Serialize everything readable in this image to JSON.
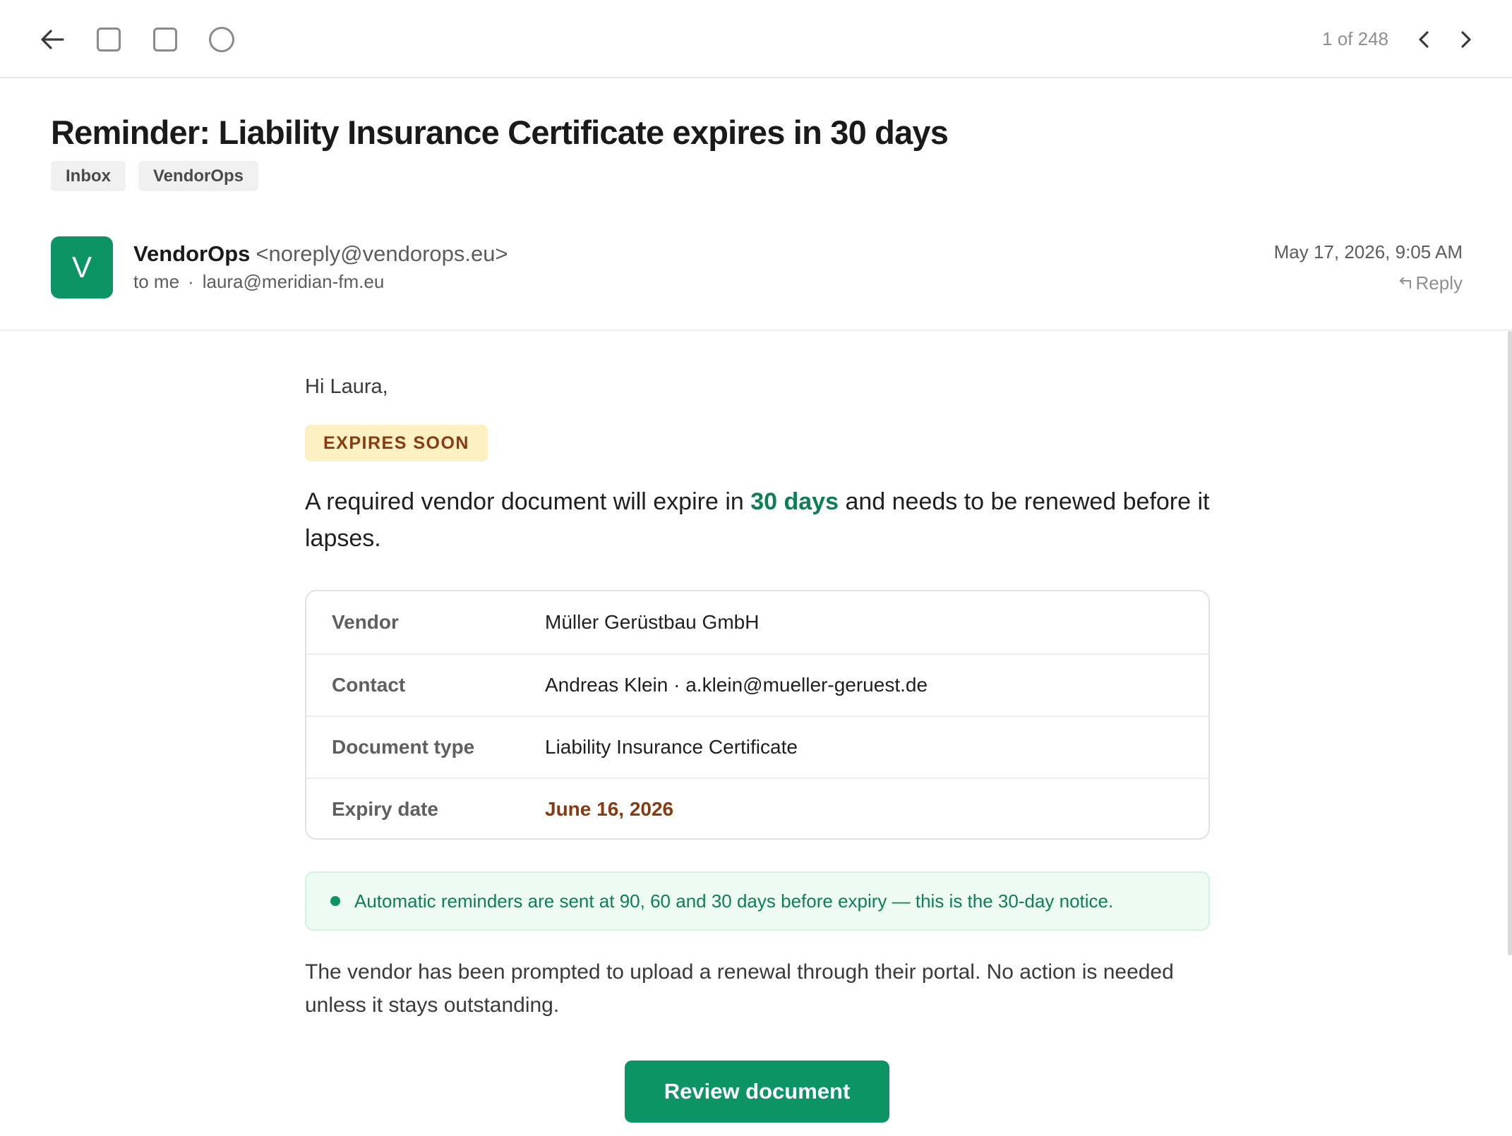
{
  "toolbar": {
    "icons": [
      "back-arrow-icon",
      "archive-icon",
      "label-icon",
      "status-circle-icon"
    ],
    "counter": "1 of 248"
  },
  "email": {
    "subject": "Reminder: Liability Insurance Certificate expires in 30 days",
    "labels": [
      "Inbox",
      "VendorOps"
    ],
    "sender": {
      "avatar_letter": "V",
      "name": "VendorOps",
      "email": "<noreply@vendorops.eu>",
      "to": "to me",
      "separator": "·",
      "recipient": "laura@meridian-fm.eu"
    },
    "date": "May 17, 2026, 9:05 AM",
    "reply_label": "Reply"
  },
  "body": {
    "greeting": "Hi Laura,",
    "badge": "EXPIRES SOON",
    "intro_before": "A required vendor document will expire in ",
    "intro_highlight": "30 days",
    "intro_after": " and needs to be renewed before it lapses.",
    "details": [
      {
        "key": "Vendor",
        "value": "Müller Gerüstbau GmbH"
      },
      {
        "key": "Contact",
        "value": "Andreas Klein · a.klein@mueller-geruest.de"
      },
      {
        "key": "Document type",
        "value": "Liability Insurance Certificate"
      },
      {
        "key": "Expiry date",
        "value": "June 16, 2026"
      }
    ],
    "notice": "Automatic reminders are sent at 90, 60 and 30 days before expiry — this is the 30-day notice.",
    "closing": "The vendor has been prompted to upload a renewal through their portal. No action is needed unless it stays outstanding.",
    "cta": "Review document"
  },
  "colors": {
    "brand": "#0d9464",
    "brand_text": "#0d7f55",
    "warning_bg": "#fdf0c2",
    "warning_text": "#8a3a10",
    "notice_bg": "#edfbf3"
  }
}
